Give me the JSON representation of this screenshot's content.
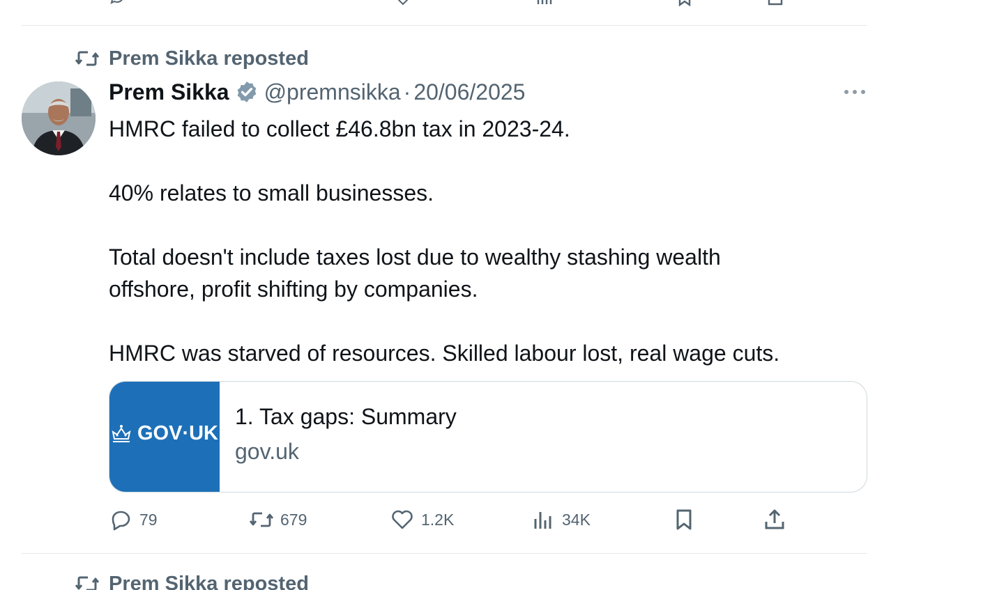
{
  "tweet": {
    "repost_label": "Prem Sikka reposted",
    "author_name": "Prem Sikka",
    "handle": "@premnsikka",
    "separator": "·",
    "date": "20/06/2025",
    "paragraphs": [
      "HMRC failed to collect £46.8bn tax in 2023-24.",
      "40% relates to small businesses.",
      "Total doesn't include taxes lost due to wealthy stashing wealth offshore, profit shifting by companies.",
      "HMRC was starved of resources. Skilled labour lost, real wage cuts."
    ],
    "card": {
      "logo_text": "GOV·UK",
      "title": "1. Tax gaps: Summary",
      "domain": "gov.uk"
    },
    "actions": {
      "replies": "79",
      "reposts": "679",
      "likes": "1.2K",
      "views": "34K"
    }
  },
  "next_tweet": {
    "repost_label": "Prem Sikka reposted"
  },
  "colors": {
    "secondary_text": "#536471",
    "primary_text": "#0f1419",
    "divider": "#e3e6e9",
    "govuk_blue": "#1d70b8",
    "govuk_dot": "#00ffe0"
  }
}
